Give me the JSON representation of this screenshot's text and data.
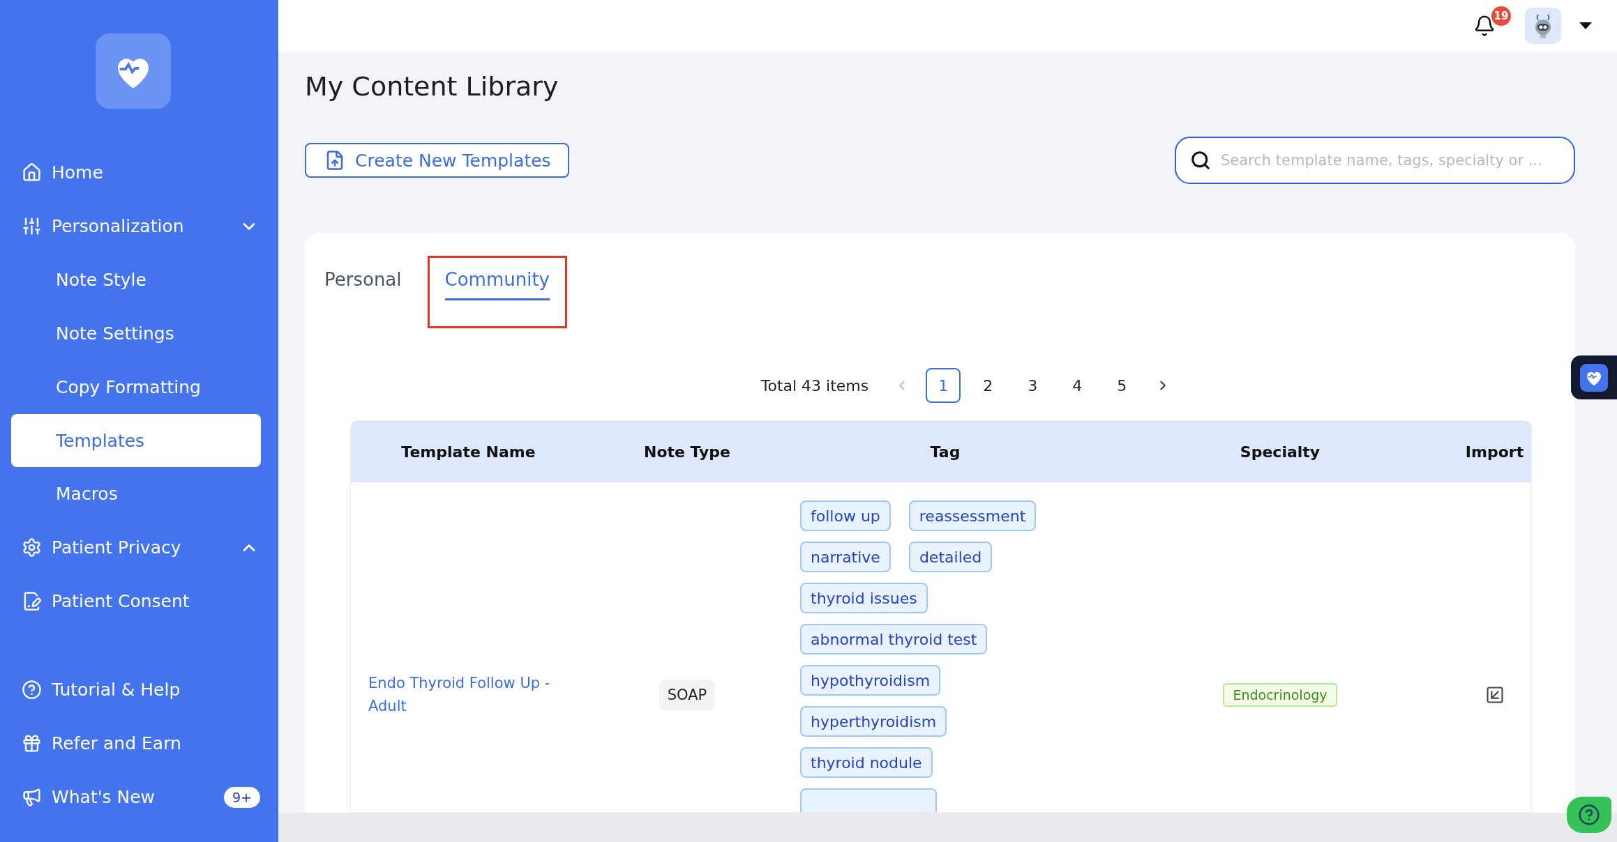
{
  "sidebar": {
    "items": [
      {
        "label": "Home",
        "kind": "top",
        "selected": false
      },
      {
        "label": "Personalization",
        "kind": "group",
        "expanded": true,
        "selected": false
      },
      {
        "label": "Note Style",
        "kind": "sub",
        "selected": false
      },
      {
        "label": "Note Settings",
        "kind": "sub",
        "selected": false
      },
      {
        "label": "Copy Formatting",
        "kind": "sub",
        "selected": false
      },
      {
        "label": "Templates",
        "kind": "sub",
        "selected": true
      },
      {
        "label": "Macros",
        "kind": "sub",
        "selected": false
      },
      {
        "label": "Patient Privacy",
        "kind": "group",
        "expanded": false,
        "selected": false
      },
      {
        "label": "Patient Consent",
        "kind": "top",
        "selected": false
      },
      {
        "kind": "spacer"
      },
      {
        "label": "Tutorial & Help",
        "kind": "top",
        "selected": false
      },
      {
        "label": "Refer and Earn",
        "kind": "top",
        "selected": false
      },
      {
        "label": "What's New",
        "kind": "top",
        "selected": false,
        "badge": "9+"
      }
    ]
  },
  "header": {
    "notification_count": "19"
  },
  "page": {
    "title": "My Content Library",
    "create_button": "Create New Templates",
    "search": {
      "placeholder": "Search template name, tags, specialty or ..."
    }
  },
  "tabs": [
    {
      "label": "Personal",
      "selected": false,
      "highlighted": false
    },
    {
      "label": "Community",
      "selected": true,
      "highlighted": true
    }
  ],
  "pagination": {
    "total": "Total 43 items",
    "pages": [
      {
        "label": "1",
        "selected": true
      },
      {
        "label": "2",
        "selected": false
      },
      {
        "label": "3",
        "selected": false
      },
      {
        "label": "4",
        "selected": false
      },
      {
        "label": "5",
        "selected": false
      }
    ]
  },
  "table": {
    "columns": [
      "Template Name",
      "Note Type",
      "Tag",
      "Specialty",
      "Import"
    ],
    "rows": [
      {
        "name": "Endo Thyroid Follow Up - Adult",
        "note_type": "SOAP",
        "tags": [
          "follow up",
          "reassessment",
          "narrative",
          "detailed",
          "thyroid issues",
          "abnormal thyroid test",
          "hypothyroidism",
          "hyperthyroidism",
          "thyroid nodule"
        ],
        "specialty": "Endocrinology"
      }
    ]
  }
}
